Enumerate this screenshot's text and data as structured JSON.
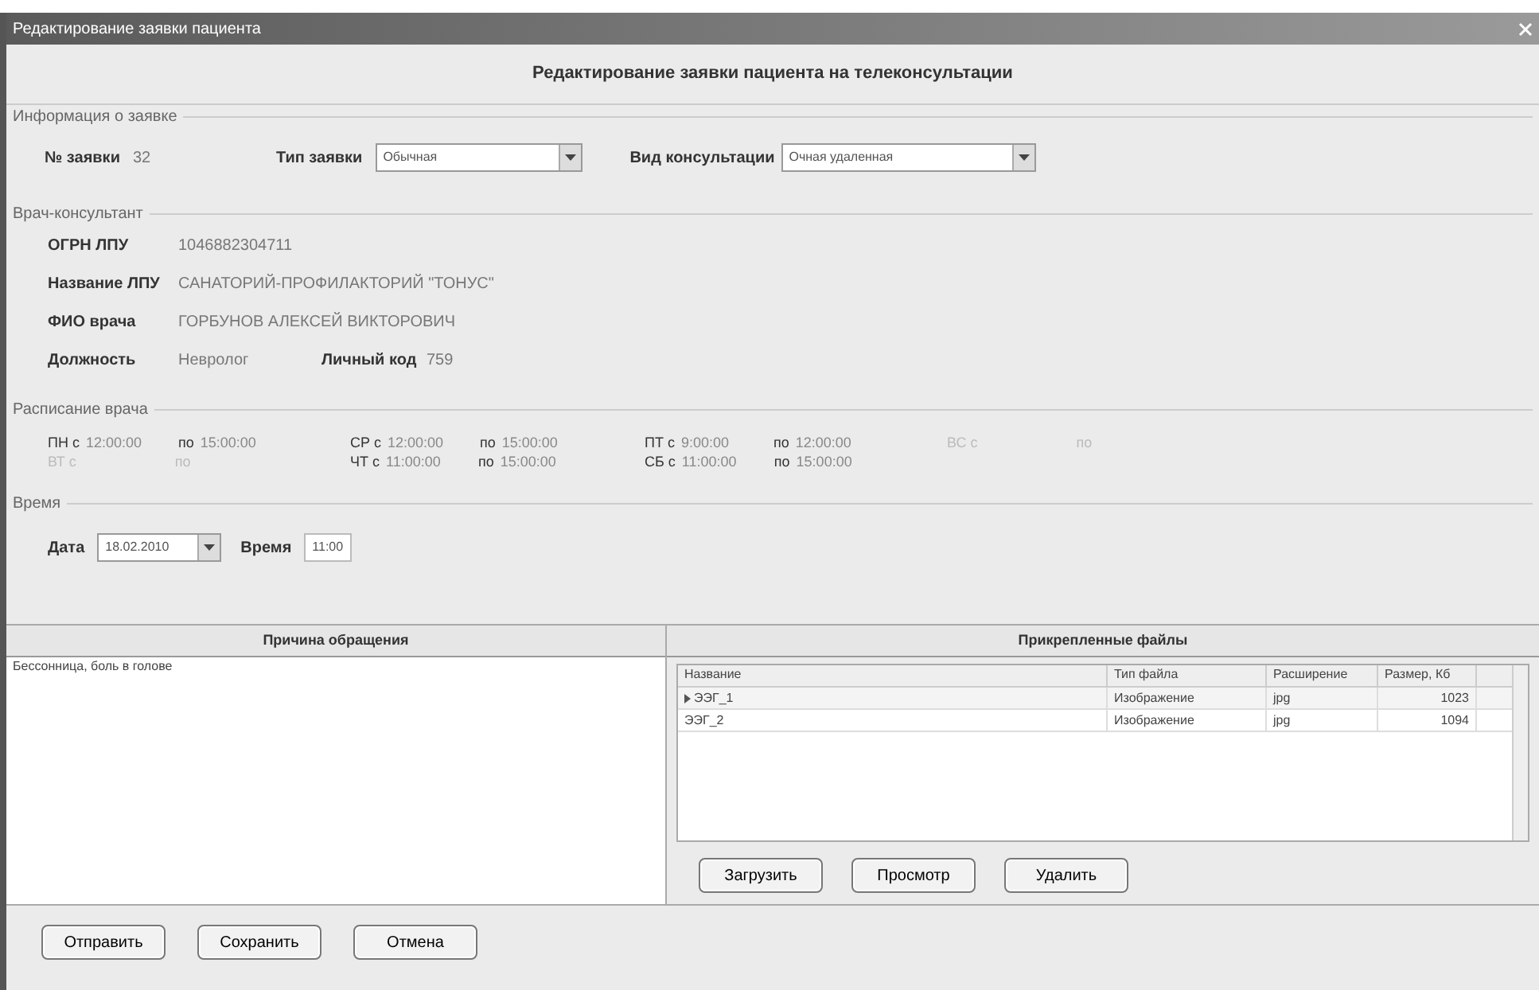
{
  "window": {
    "title": "Редактирование заявки пациента"
  },
  "header": "Редактирование заявки пациента на телеконсультации",
  "request_info": {
    "legend": "Информация о заявке",
    "number_label": "№ заявки",
    "number": "32",
    "type_label": "Тип заявки",
    "type_value": "Обычная",
    "consult_label": "Вид консультации",
    "consult_value": "Очная удаленная"
  },
  "doctor": {
    "legend": "Врач-консультант",
    "fields": [
      {
        "label": "ОГРН ЛПУ",
        "value": "1046882304711"
      },
      {
        "label": "Название ЛПУ",
        "value": "САНАТОРИЙ-ПРОФИЛАКТОРИЙ \"ТОНУС\""
      },
      {
        "label": "ФИО врача",
        "value": "ГОРБУНОВ АЛЕКСЕЙ ВИКТОРОВИЧ"
      }
    ],
    "position_label": "Должность",
    "position": "Невролог",
    "code_label": "Личный код",
    "code": "759"
  },
  "schedule": {
    "legend": "Расписание врача",
    "days": [
      {
        "from": "ПН с",
        "start": "12:00:00",
        "to": "по",
        "end": "15:00:00",
        "disabled": false
      },
      {
        "from": "ВТ с",
        "to": "по",
        "disabled": true
      },
      {
        "from": "СР с",
        "start": "12:00:00",
        "to": "по",
        "end": "15:00:00",
        "disabled": false
      },
      {
        "from": "ЧТ с",
        "start": "11:00:00",
        "to": "по",
        "end": "15:00:00",
        "disabled": false
      },
      {
        "from": "ПТ с",
        "start": "9:00:00",
        "to": "по",
        "end": "12:00:00",
        "disabled": false
      },
      {
        "from": "СБ с",
        "start": "11:00:00",
        "to": "по",
        "end": "15:00:00",
        "disabled": false
      },
      {
        "from": "ВС с",
        "to": "по",
        "disabled": true
      }
    ]
  },
  "time": {
    "legend": "Время",
    "date_label": "Дата",
    "date": "18.02.2010",
    "time_label": "Время",
    "time": "11:00"
  },
  "reason": {
    "title": "Причина обращения",
    "text": "Бессонница, боль в голове"
  },
  "files": {
    "title": "Прикрепленные файлы",
    "columns": [
      "Название",
      "Тип файла",
      "Расширение",
      "Размер, Кб"
    ],
    "rows": [
      {
        "cells": [
          "ЭЭГ_1",
          "Изображение",
          "jpg",
          "1023"
        ],
        "selected": true
      },
      {
        "cells": [
          "ЭЭГ_2",
          "Изображение",
          "jpg",
          "1094"
        ],
        "selected": false
      }
    ],
    "buttons": [
      "Загрузить",
      "Просмотр",
      "Удалить"
    ]
  },
  "buttons": [
    "Отправить",
    "Сохранить",
    "Отмена"
  ]
}
